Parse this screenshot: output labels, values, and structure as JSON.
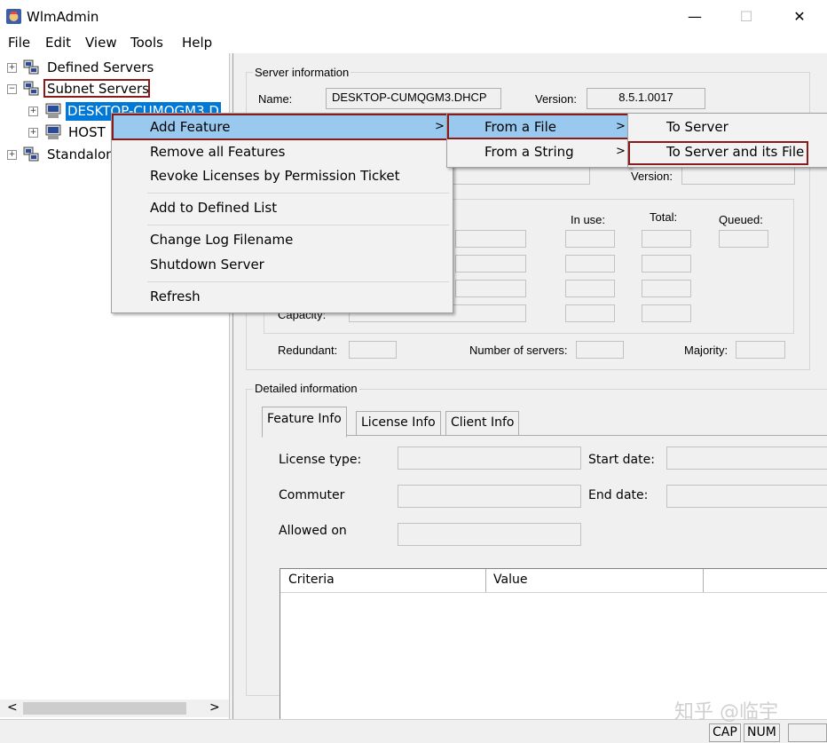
{
  "window": {
    "title": "WlmAdmin",
    "minimize_glyph": "—",
    "maximize_glyph": "☐",
    "close_glyph": "✕"
  },
  "menubar": [
    "File",
    "Edit",
    "View",
    "Tools",
    "Help"
  ],
  "tree": {
    "defined_servers": "Defined Servers",
    "subnet_servers": "Subnet Servers",
    "desktop_node": "DESKTOP-CUMQGM3.D",
    "host_node": "HOST",
    "standalone_node": "Standalon",
    "expander_plus": "+",
    "expander_minus": "−",
    "scroll_left": "<",
    "scroll_right": ">"
  },
  "server_info": {
    "legend": "Server information",
    "name_label": "Name:",
    "name_value": "DESKTOP-CUMQGM3.DHCP",
    "version_label": "Version:",
    "version_value": "8.5.1.0017",
    "version2_label": "Version:",
    "in_use_label": "In use:",
    "total_label": "Total:",
    "queued_label": "Queued:",
    "capacity_label": "Capacity:",
    "redundant_label": "Redundant:",
    "num_servers_label": "Number of servers:",
    "majority_label": "Majority:"
  },
  "detailed_info": {
    "legend": "Detailed information",
    "tabs": [
      "Feature Info",
      "License Info",
      "Client Info"
    ],
    "license_type_label": "License type:",
    "start_date_label": "Start date:",
    "commuter_label": "Commuter",
    "end_date_label": "End date:",
    "allowed_on_label": "Allowed on",
    "table_headers": [
      "Criteria",
      "Value"
    ]
  },
  "context_menu": {
    "items": [
      "Add Feature",
      "Remove all Features",
      "Revoke Licenses by Permission Ticket",
      "Add to Defined List",
      "Change Log Filename",
      "Shutdown Server",
      "Refresh"
    ],
    "submenu_arrow": ">"
  },
  "submenu_add_feature": [
    "From a File",
    "From a String"
  ],
  "submenu_from_file": [
    "To Server",
    "To Server and its File"
  ],
  "statusbar": {
    "cap": "CAP",
    "num": "NUM"
  },
  "watermark": "知乎 @临宇",
  "colors": {
    "highlight": "#99c9ef",
    "selection": "#0078d7",
    "annotation_border": "#8b1a1a"
  },
  "icons": {
    "app": "app-icon",
    "server": "server-icon"
  }
}
